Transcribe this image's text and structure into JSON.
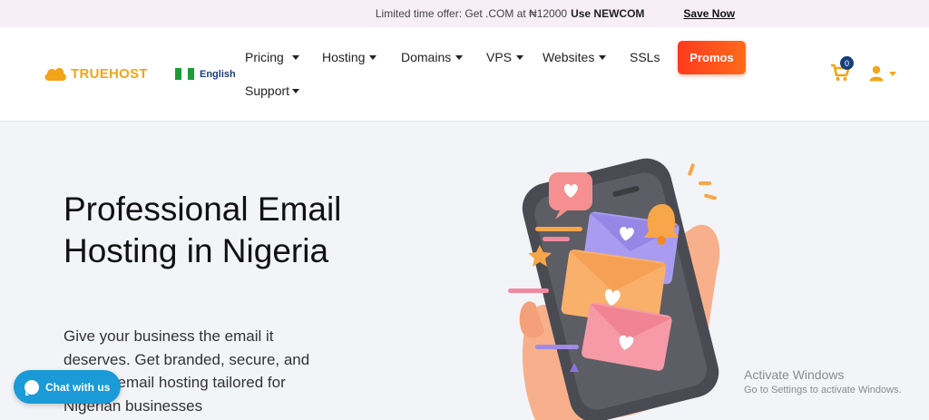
{
  "promo": {
    "text": "Limited time offer: Get .COM at ₦12000",
    "code": "Use NEWCOM",
    "save": "Save Now"
  },
  "brand": {
    "name": "TRUEHOST",
    "accent": "#f3a417"
  },
  "language": {
    "label": "English",
    "flag": "nigeria-flag-icon"
  },
  "nav": {
    "pricing": "Pricing",
    "hosting": "Hosting",
    "domains": "Domains",
    "vps": "VPS",
    "websites": "Websites",
    "ssls": "SSLs",
    "promos": "Promos",
    "support": "Support"
  },
  "cart": {
    "count": "0"
  },
  "hero": {
    "title": "Professional Email Hosting in Nigeria",
    "description": "Give your business the email it deserves. Get branded, secure, and reliable email hosting tailored for Nigerian businesses"
  },
  "chat": {
    "label": "Chat with us"
  },
  "windows_notice": {
    "title": "Activate Windows",
    "subtitle": "Go to Settings to activate Windows."
  },
  "colors": {
    "promos_button": "#ff4a1c",
    "chat_button": "#1a9ad6",
    "badge": "#173f7c"
  }
}
